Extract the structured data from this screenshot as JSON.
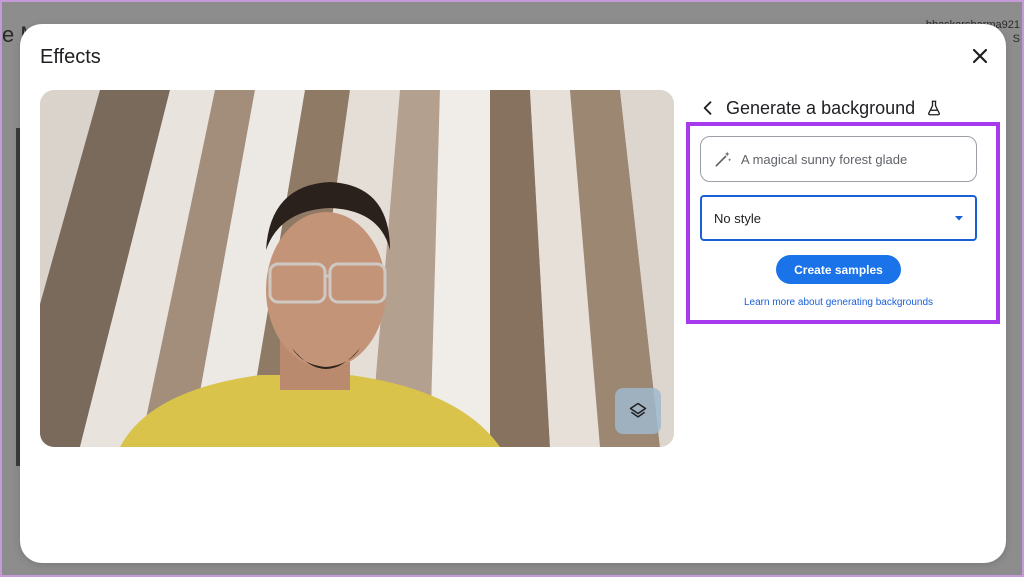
{
  "background": {
    "app_title_fragment": "e M",
    "user_line1": "bhaskarsharma921",
    "user_line2": "S"
  },
  "dialog": {
    "title": "Effects",
    "close_icon": "close-icon"
  },
  "preview": {
    "layers_icon": "layers-icon"
  },
  "panel": {
    "back_icon": "chevron-left-icon",
    "title": "Generate a background",
    "lab_icon": "flask-icon",
    "prompt_icon": "magic-wand-icon",
    "prompt_text": "A magical sunny forest glade",
    "style_value": "No style",
    "style_icon": "caret-down-icon",
    "create_label": "Create samples",
    "learn_more_label": "Learn more about generating backgrounds"
  },
  "colors": {
    "accent_blue": "#1a73e8",
    "highlight_purple": "#a63aec",
    "scrim": "#8e8e8e"
  }
}
